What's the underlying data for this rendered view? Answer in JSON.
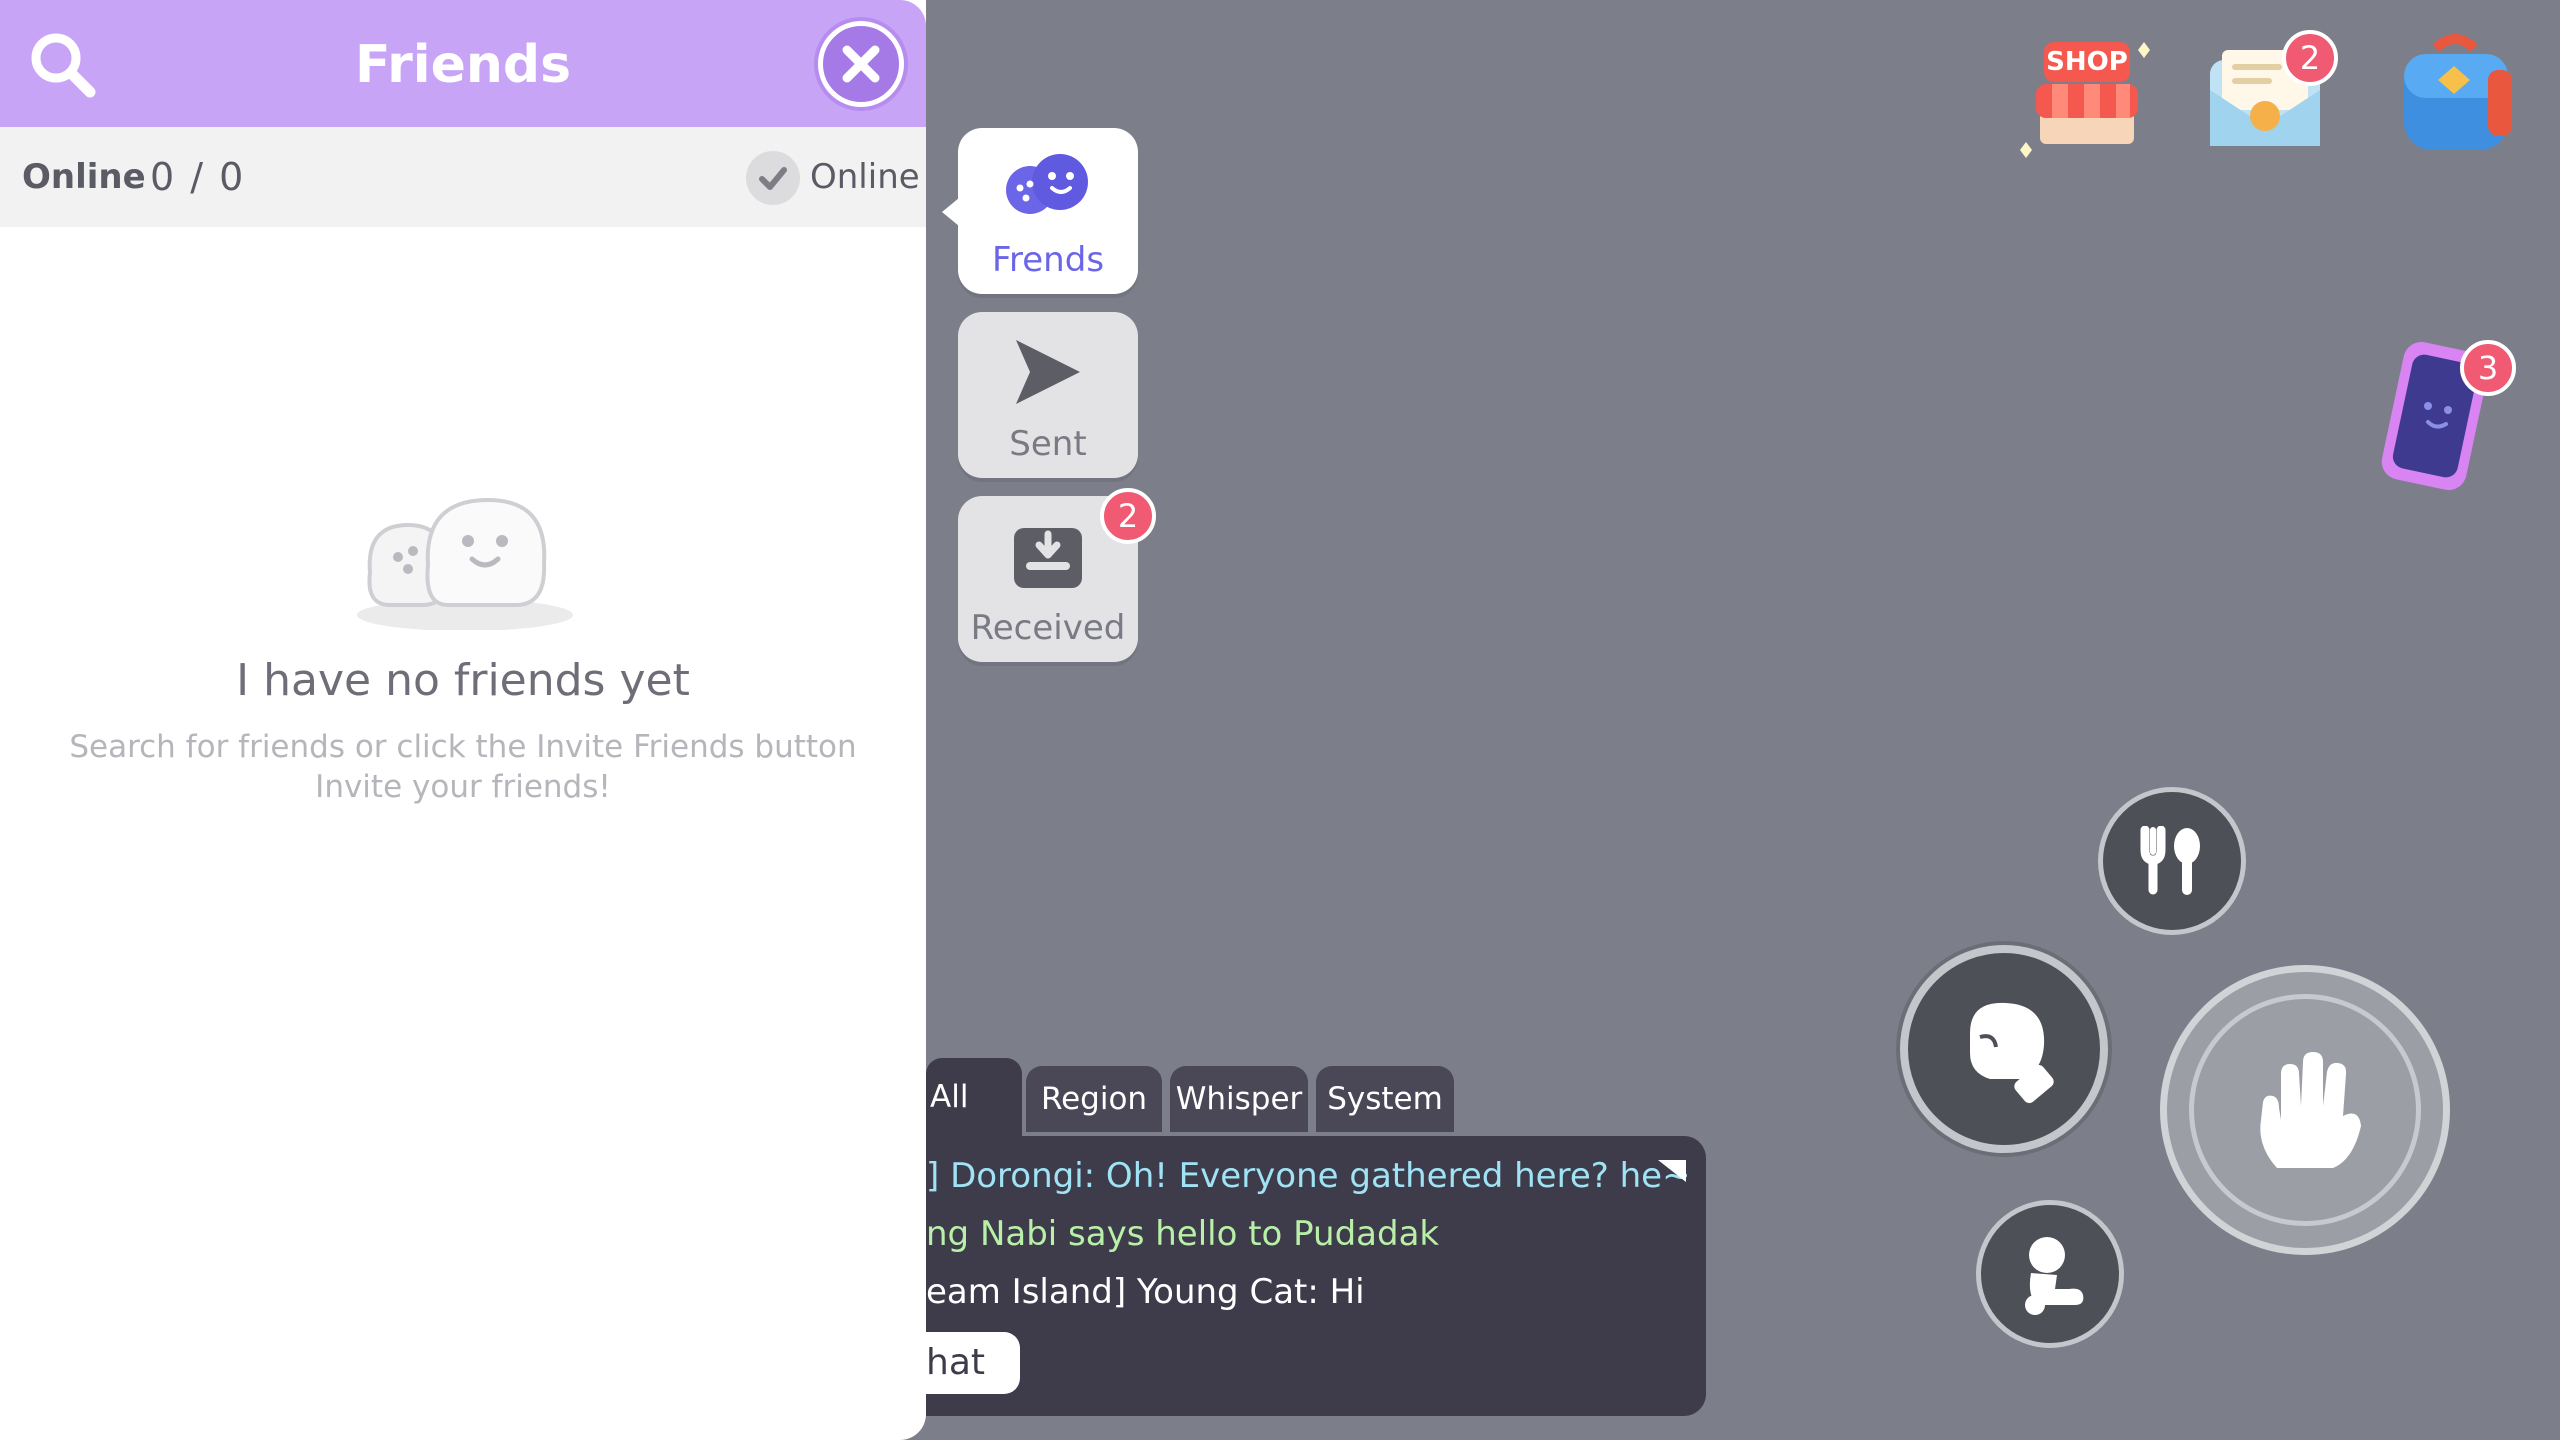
{
  "friends_panel": {
    "title": "Friends",
    "online_label": "Online",
    "online_count": "0 / 0",
    "online_toggle_label": "Online",
    "empty_title": "I have no friends yet",
    "empty_desc_line1": "Search for friends or click the Invite Friends button",
    "empty_desc_line2": "Invite your friends!"
  },
  "side_tabs": {
    "friends": "Frends",
    "sent": "Sent",
    "received": "Received",
    "received_badge": "2"
  },
  "top_icons": {
    "shop_label": "SHOP",
    "mail_badge": "2",
    "card_badge": "3"
  },
  "chat": {
    "tabs": [
      "All",
      "Region",
      "Whisper",
      "System"
    ],
    "lines": [
      "] Dorongi: Oh! Everyone gathered here? he~",
      "ng Nabi says hello to Pudadak",
      "eam Island] Young Cat: Hi"
    ],
    "input_label": "hat"
  },
  "colors": {
    "background": "#7c7f8a",
    "header_purple": "#c7a4f5",
    "badge_red": "#f05a72",
    "friends_tab_blue": "#6b65e8",
    "chat_bg": "#3e3c4b"
  }
}
